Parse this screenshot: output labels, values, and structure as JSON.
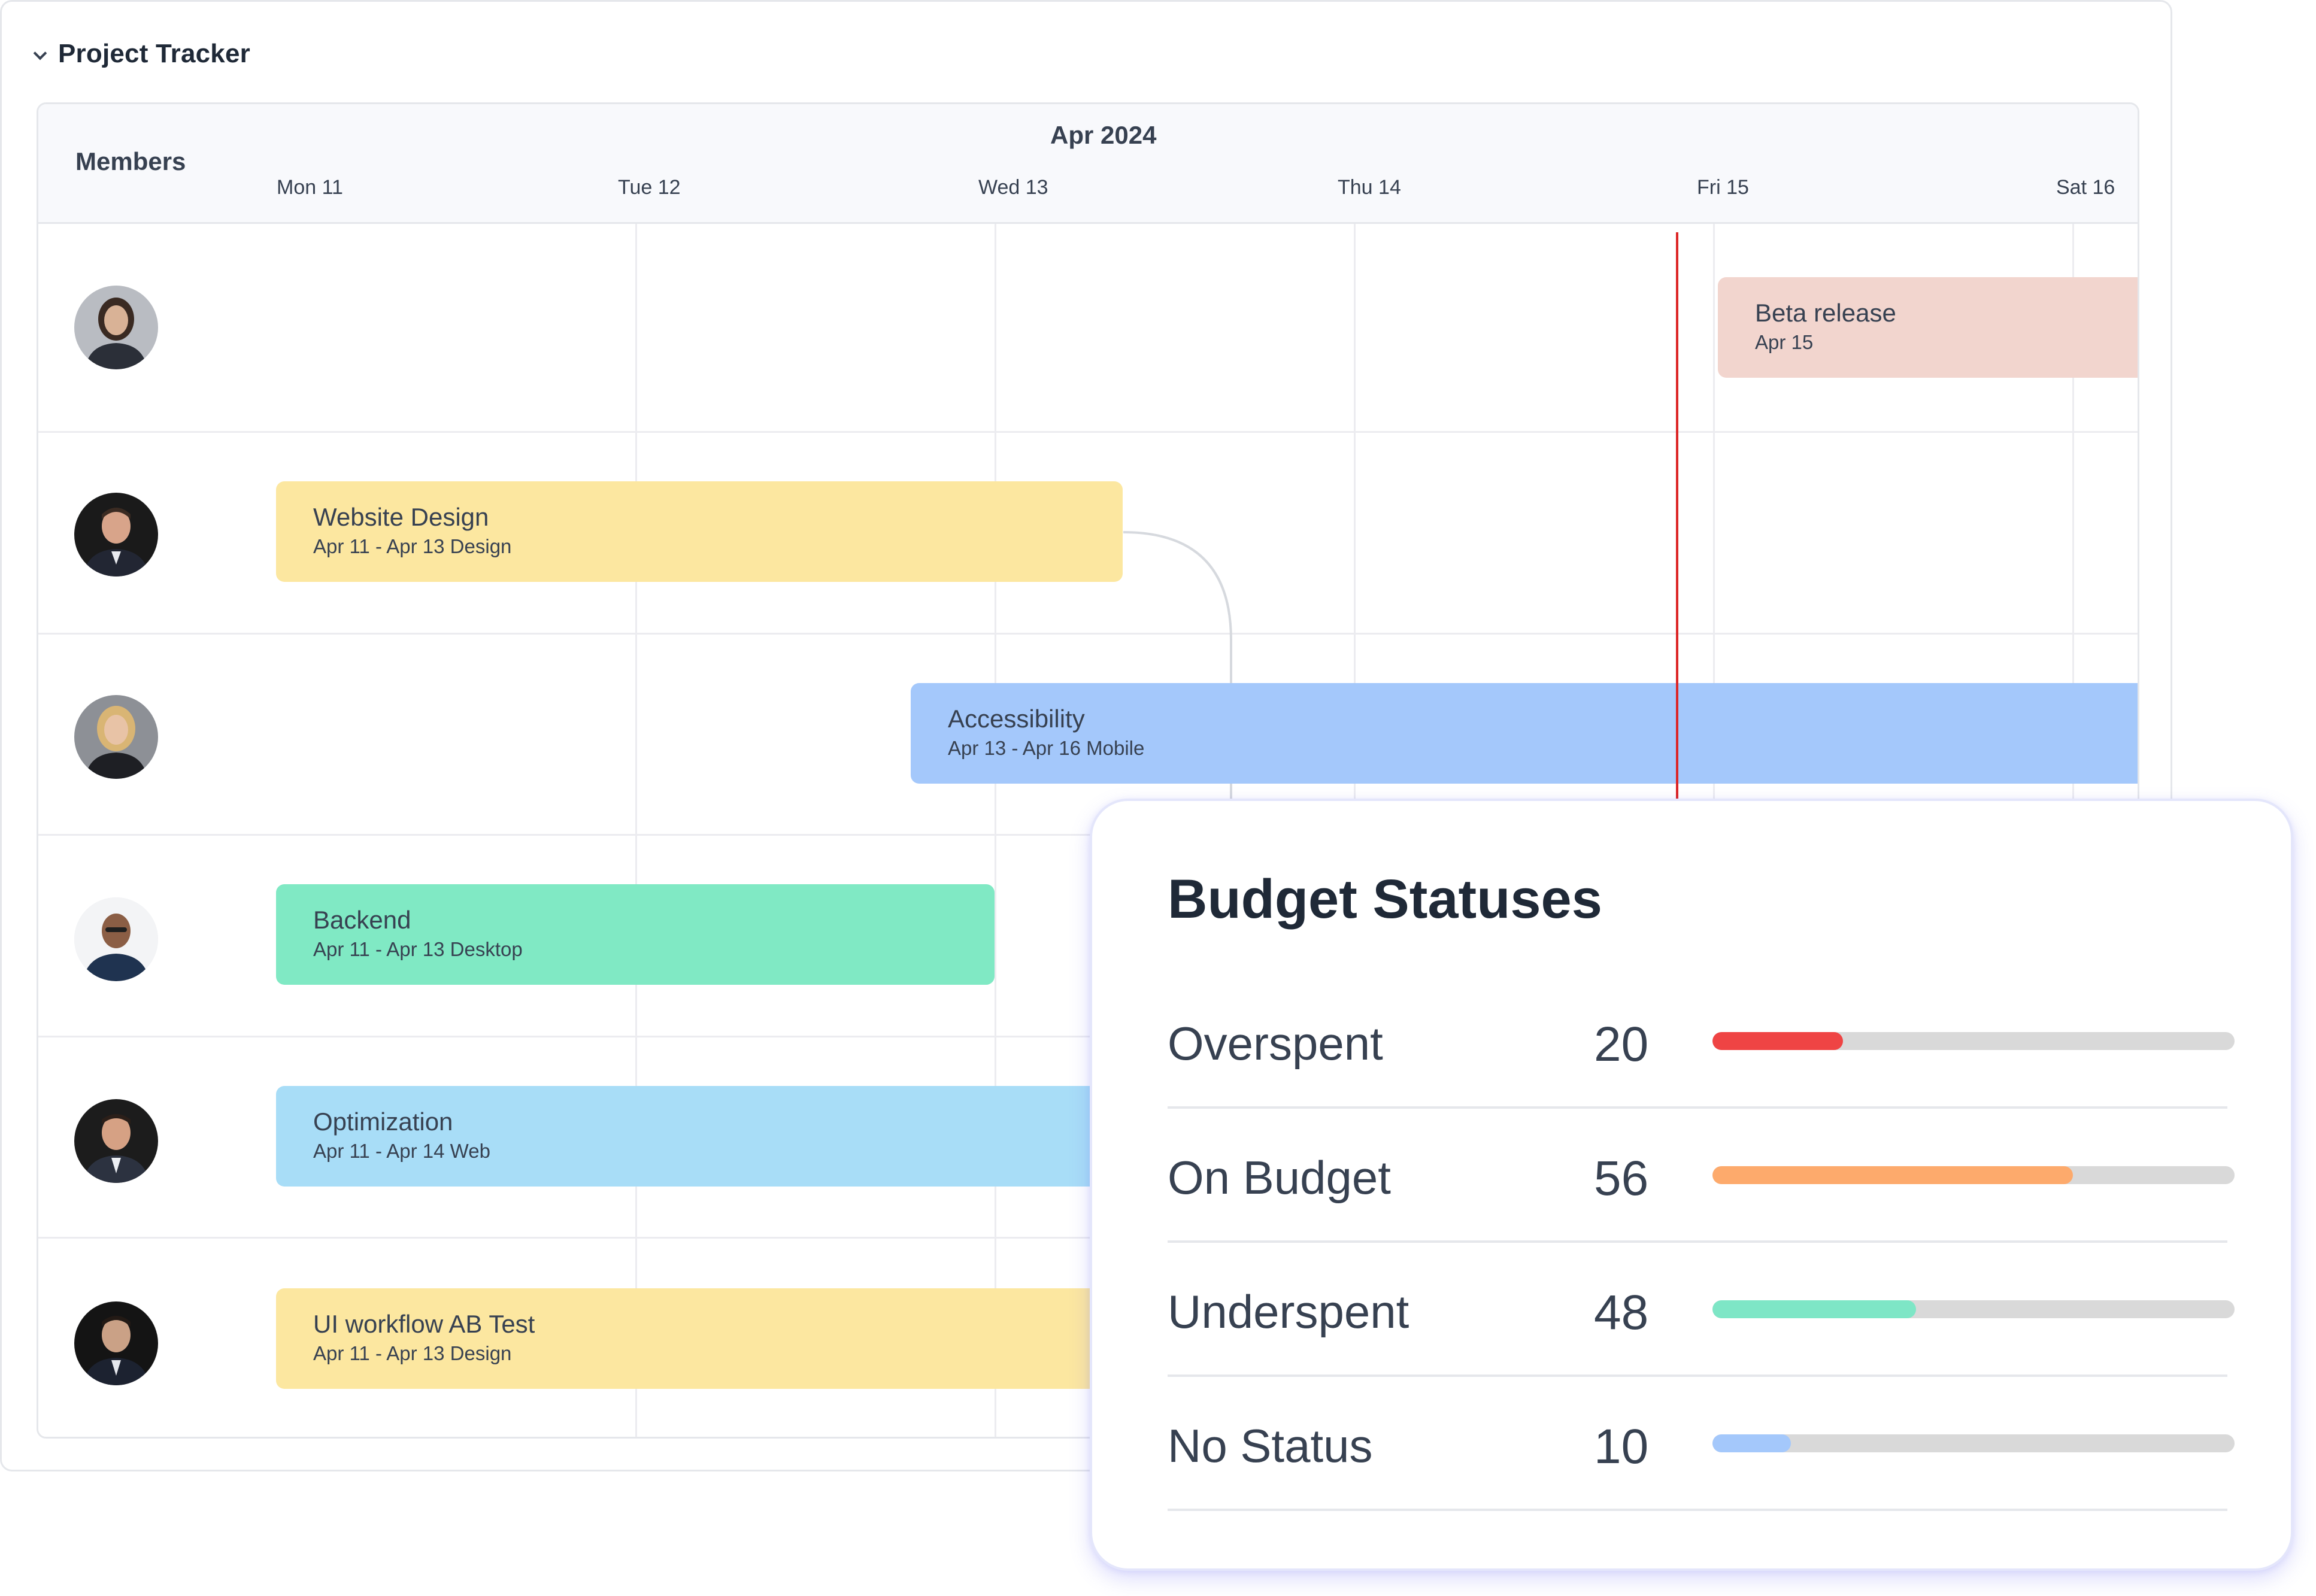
{
  "tracker": {
    "title": "Project Tracker",
    "members_label": "Members",
    "month_label": "Apr 2024",
    "days": [
      "Mon 11",
      "Tue 12",
      "Wed 13",
      "Thu 14",
      "Fri 15",
      "Sat 16"
    ]
  },
  "members": [
    {
      "avatar": "woman-business-portrait"
    },
    {
      "avatar": "man-business-portrait"
    },
    {
      "avatar": "blonde-woman-portrait"
    },
    {
      "avatar": "man-glasses-portrait"
    },
    {
      "avatar": "man-suit-portrait"
    },
    {
      "avatar": "young-man-suit-portrait"
    }
  ],
  "tasks": [
    {
      "name": "Beta release",
      "sub": "Apr 15",
      "color": "#f2d5ce"
    },
    {
      "name": "Website Design",
      "sub": "Apr 11 - Apr 13 Design",
      "color": "#fce7a0"
    },
    {
      "name": "Accessibility",
      "sub": "Apr 13 - Apr 16 Mobile",
      "color": "#a4c8fb"
    },
    {
      "name": "Backend",
      "sub": "Apr 11 - Apr 13 Desktop",
      "color": "#80e9c4"
    },
    {
      "name": "Optimization",
      "sub": "Apr 11 - Apr 14 Web",
      "color": "#a8ddf7"
    },
    {
      "name": "UI workflow AB Test",
      "sub": "Apr 11 - Apr 13 Design",
      "color": "#fce7a0"
    }
  ],
  "budget": {
    "title": "Budget Statuses",
    "statuses": [
      {
        "label": "Overspent",
        "value": "20",
        "fraction": 0.25,
        "color": "#ef4444"
      },
      {
        "label": "On Budget",
        "value": "56",
        "fraction": 0.69,
        "color": "#fdaa6c"
      },
      {
        "label": "Underspent",
        "value": "48",
        "fraction": 0.39,
        "color": "#7ee6c6"
      },
      {
        "label": "No Status",
        "value": "10",
        "fraction": 0.15,
        "color": "#a4c8fb"
      }
    ]
  }
}
